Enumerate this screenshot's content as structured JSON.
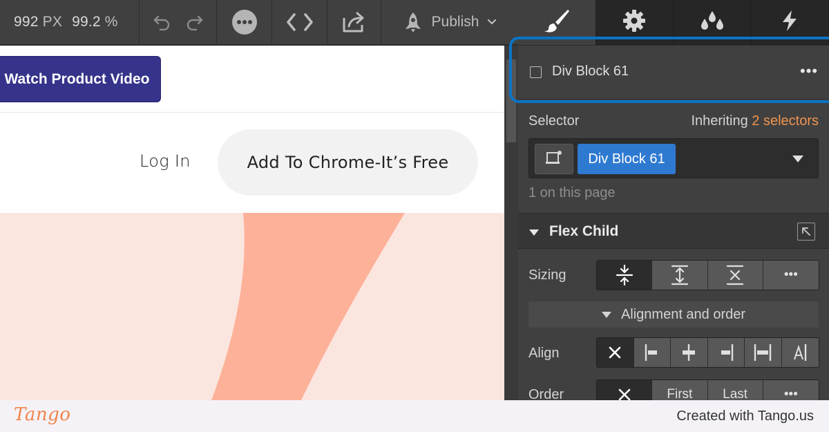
{
  "toolbar": {
    "width_value": "992",
    "width_unit": "PX",
    "zoom_value": "99.2",
    "zoom_unit": "%",
    "publish_label": "Publish"
  },
  "panel_tabs": [
    {
      "name": "style",
      "icon": "paintbrush-icon",
      "active": true
    },
    {
      "name": "settings",
      "icon": "gear-icon",
      "active": false
    },
    {
      "name": "interactions",
      "icon": "drops-icon",
      "active": false
    },
    {
      "name": "lightning",
      "icon": "lightning-icon",
      "active": false
    }
  ],
  "canvas": {
    "watch_button": "Watch Product Video",
    "login_link": "Log In",
    "chrome_button": "Add To Chrome-It’s Free",
    "colors": {
      "watch_button": "#35338a",
      "hero_bg": "#fbe5df",
      "hero_shape": "#fdb199"
    }
  },
  "panel": {
    "element_name": "Div Block 61",
    "selector_label": "Selector",
    "inheriting_prefix": "Inheriting",
    "inheriting_count": "2 selectors",
    "selector_tag": "Div Block 61",
    "on_page": "1 on this page",
    "flex_child_title": "Flex Child",
    "sizing_label": "Sizing",
    "alignment_order_label": "Alignment and order",
    "align_label": "Align",
    "order_label": "Order",
    "order_options": {
      "first": "First",
      "last": "Last"
    },
    "accent_color": "#f0944f",
    "selector_tag_color": "#2f7ad1"
  },
  "footer": {
    "logo": "Tango",
    "credit": "Created with Tango.us"
  }
}
